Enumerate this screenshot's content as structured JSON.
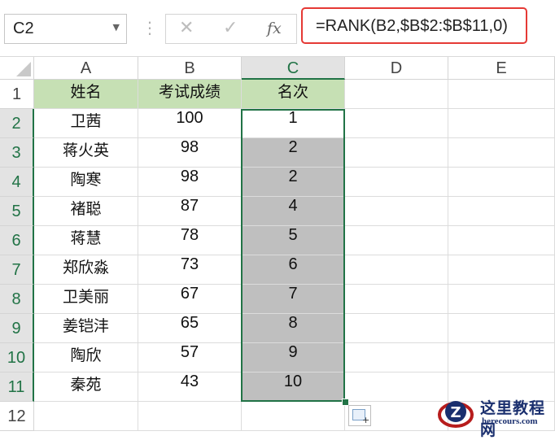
{
  "formula_bar": {
    "name_box": "C2",
    "formula": "=RANK(B2,$B$2:$B$11,0)",
    "cancel_icon": "✕",
    "enter_icon": "✓",
    "fx_label": "fx"
  },
  "columns": [
    "A",
    "B",
    "C",
    "D",
    "E"
  ],
  "rows": [
    "1",
    "2",
    "3",
    "4",
    "5",
    "6",
    "7",
    "8",
    "9",
    "10",
    "11",
    "12"
  ],
  "table": {
    "headers": [
      "姓名",
      "考试成绩",
      "名次"
    ],
    "rows": [
      {
        "name": "卫茜",
        "score": "100",
        "rank": "1"
      },
      {
        "name": "蒋火英",
        "score": "98",
        "rank": "2"
      },
      {
        "name": "陶寒",
        "score": "98",
        "rank": "2"
      },
      {
        "name": "褚聪",
        "score": "87",
        "rank": "4"
      },
      {
        "name": "蒋慧",
        "score": "78",
        "rank": "5"
      },
      {
        "name": "郑欣淼",
        "score": "73",
        "rank": "6"
      },
      {
        "name": "卫美丽",
        "score": "67",
        "rank": "7"
      },
      {
        "name": "姜铠沣",
        "score": "65",
        "rank": "8"
      },
      {
        "name": "陶欣",
        "score": "57",
        "rank": "9"
      },
      {
        "name": "秦苑",
        "score": "43",
        "rank": "10"
      }
    ]
  },
  "selection": {
    "active_cell": "C2",
    "range": "C2:C11"
  },
  "colors": {
    "header_fill": "#c6e0b4",
    "selected_fill": "#bfbfbf",
    "selection_border": "#217346",
    "formula_highlight": "#e53935"
  },
  "watermark": {
    "title": "这里教程网",
    "url": "herecours.com"
  }
}
